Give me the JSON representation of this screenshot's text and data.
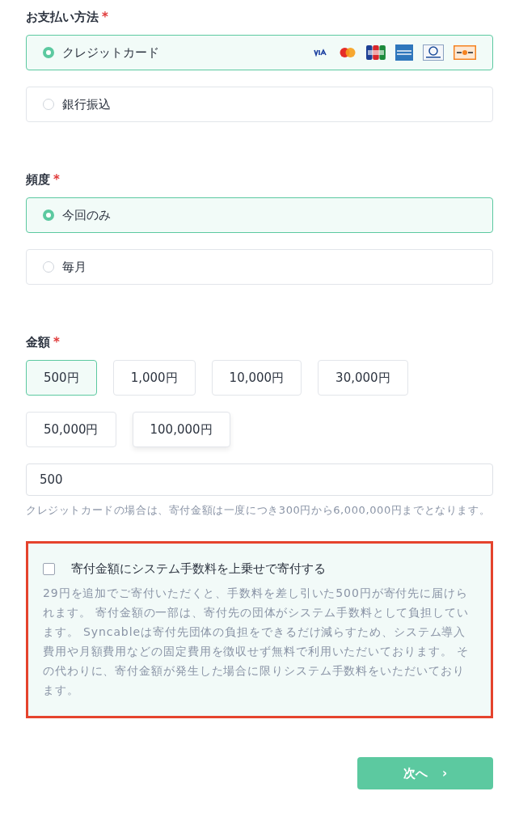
{
  "payment": {
    "label": "お支払い方法",
    "required_mark": "*",
    "options": [
      {
        "label": "クレジットカード",
        "selected": true,
        "card_logos": true
      },
      {
        "label": "銀行振込",
        "selected": false
      }
    ]
  },
  "frequency": {
    "label": "頻度",
    "required_mark": "*",
    "options": [
      {
        "label": "今回のみ",
        "selected": true
      },
      {
        "label": "毎月",
        "selected": false
      }
    ]
  },
  "amount": {
    "label": "金額",
    "required_mark": "*",
    "presets": [
      {
        "label": "500円",
        "selected": true
      },
      {
        "label": "1,000円",
        "selected": false
      },
      {
        "label": "10,000円",
        "selected": false
      },
      {
        "label": "30,000円",
        "selected": false
      },
      {
        "label": "50,000円",
        "selected": false
      },
      {
        "label": "100,000円",
        "selected": false
      }
    ],
    "value": "500",
    "help": "クレジットカードの場合は、寄付金額は一度につき300円から6,000,000円までとなります。"
  },
  "fee": {
    "checked": false,
    "label": "寄付金額にシステム手数料を上乗せで寄付する",
    "description": "29円を追加でご寄付いただくと、手数料を差し引いた500円が寄付先に届けられます。 寄付金額の一部は、寄付先の団体がシステム手数料として負担しています。 Syncableは寄付先団体の負担をできるだけ減らすため、システム導入費用や月額費用などの固定費用を徴収せず無料で利用いただいております。 その代わりに、寄付金額が発生した場合に限りシステム手数料をいただいております。"
  },
  "next_button": {
    "label": "次へ",
    "arrow": "›"
  }
}
